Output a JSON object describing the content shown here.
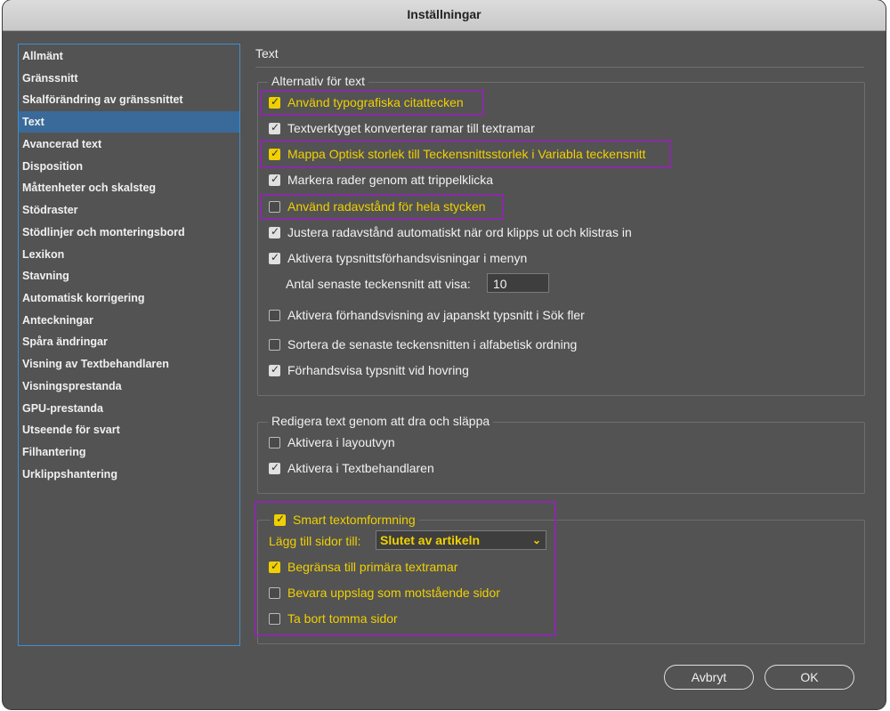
{
  "window": {
    "title": "Inställningar"
  },
  "sidebar": {
    "items": [
      "Allmänt",
      "Gränssnitt",
      "Skalförändring av gränssnittet",
      "Text",
      "Avancerad text",
      "Disposition",
      "Måttenheter och skalsteg",
      "Stödraster",
      "Stödlinjer och monteringsbord",
      "Lexikon",
      "Stavning",
      "Automatisk korrigering",
      "Anteckningar",
      "Spåra ändringar",
      "Visning av Textbehandlaren",
      "Visningsprestanda",
      "GPU-prestanda",
      "Utseende för svart",
      "Filhantering",
      "Urklippshantering"
    ],
    "selected": "Text"
  },
  "page": {
    "heading": "Text"
  },
  "text_options": {
    "title": "Alternativ för text",
    "typographic_quotes": {
      "label": "Använd typografiska citattecken",
      "checked": true
    },
    "type_tool_frames": {
      "label": "Textverktyget konverterar ramar till textramar",
      "checked": true
    },
    "optical_size": {
      "label": "Mappa Optisk storlek till Teckensnittsstorlek i Variabla teckensnitt",
      "checked": true
    },
    "triple_click": {
      "label": "Markera rader genom att trippelklicka",
      "checked": true
    },
    "leading_whole": {
      "label": "Använd radavstånd för hela stycken",
      "checked": false
    },
    "adjust_spacing": {
      "label": "Justera radavstånd automatiskt när ord klipps ut och klistras in",
      "checked": true
    },
    "font_preview_menu": {
      "label": "Aktivera typsnittsförhandsvisningar i menyn",
      "checked": true
    },
    "recent_fonts_label": "Antal senaste teckensnitt att visa:",
    "recent_fonts_value": "10",
    "japanese_preview": {
      "label": "Aktivera förhandsvisning av japanskt typsnitt i Sök fler",
      "checked": false
    },
    "sort_recent": {
      "label": "Sortera de senaste teckensnitten i alfabetisk ordning",
      "checked": false
    },
    "hover_preview": {
      "label": "Förhandsvisa typsnitt vid hovring",
      "checked": true
    }
  },
  "drag_drop": {
    "title": "Redigera text genom att dra och släppa",
    "layout_view": {
      "label": "Aktivera i layoutvyn",
      "checked": false
    },
    "story_editor": {
      "label": "Aktivera i Textbehandlaren",
      "checked": true
    }
  },
  "smart_reflow": {
    "title": {
      "label": "Smart textomformning",
      "checked": true
    },
    "add_pages_label": "Lägg till sidor till:",
    "add_pages_value": "Slutet av artikeln",
    "limit_primary": {
      "label": "Begränsa till primära textramar",
      "checked": true
    },
    "preserve_spreads": {
      "label": "Bevara uppslag som motstående sidor",
      "checked": false
    },
    "delete_empty": {
      "label": "Ta bort tomma sidor",
      "checked": false
    }
  },
  "buttons": {
    "cancel": "Avbryt",
    "ok": "OK"
  },
  "colors": {
    "highlight_text": "#f0d000",
    "highlight_box": "#8a2aa8",
    "selection": "#3a6a9a",
    "sidebar_border": "#3f8fd0"
  }
}
